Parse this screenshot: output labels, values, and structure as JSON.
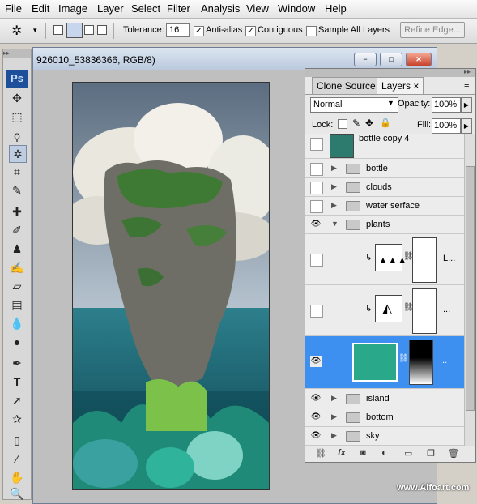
{
  "menu": [
    "File",
    "Edit",
    "Image",
    "Layer",
    "Select",
    "Filter",
    "Analysis",
    "View",
    "Window",
    "Help"
  ],
  "options": {
    "tolerance_label": "Tolerance:",
    "tolerance_value": "16",
    "antialias_label": "Anti-alias",
    "antialias_checked": "✓",
    "contiguous_label": "Contiguous",
    "contiguous_checked": "✓",
    "sample_all_label": "Sample All Layers",
    "refine_edge_label": "Refine Edge..."
  },
  "toolbox": {
    "logo": "Ps",
    "tools": [
      "move-icon",
      "marquee-icon",
      "lasso-icon",
      "magic-wand-icon",
      "crop-icon",
      "eyedropper-icon",
      "healing-icon",
      "brush-icon",
      "stamp-icon",
      "history-brush-icon",
      "eraser-icon",
      "gradient-icon",
      "blur-icon",
      "dodge-icon",
      "pen-icon",
      "type-icon",
      "path-select-icon",
      "shape-icon",
      "notes-icon",
      "eyedropper2-icon",
      "hand-icon",
      "zoom-icon"
    ]
  },
  "document": {
    "title": "926010_53836366, RGB/8)",
    "minimize": "−",
    "restore": "□",
    "close": "✕"
  },
  "panel": {
    "tab_clone": "Clone Source",
    "tab_layers": "Layers",
    "tab_close": "×",
    "blend_mode": "Normal",
    "opacity_label": "Opacity:",
    "opacity_value": "100%",
    "lock_label": "Lock:",
    "fill_label": "Fill:",
    "fill_value": "100%",
    "layers": [
      {
        "name": "bottle copy 4"
      },
      {
        "name": "bottle"
      },
      {
        "name": "clouds"
      },
      {
        "name": "water serface"
      },
      {
        "name": "plants"
      },
      {
        "name": "L..."
      },
      {
        "name": "..."
      },
      {
        "name": "..."
      },
      {
        "name": "island"
      },
      {
        "name": "bottom"
      },
      {
        "name": "sky"
      }
    ]
  },
  "watermark": "www.Alfoart.com",
  "colors": {
    "selected_row": "#3d8ff0",
    "ps_logo": "#1d4f9a"
  }
}
